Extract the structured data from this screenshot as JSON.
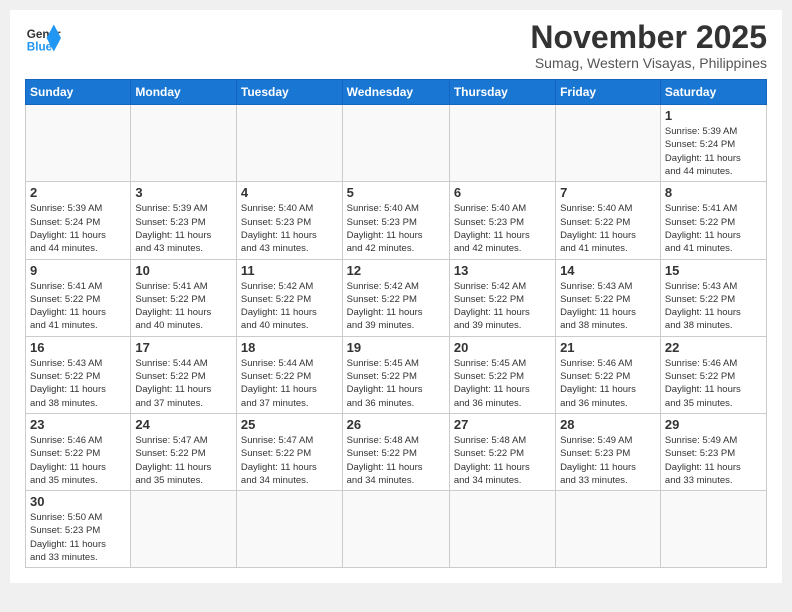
{
  "header": {
    "logo_general": "General",
    "logo_blue": "Blue",
    "month_title": "November 2025",
    "subtitle": "Sumag, Western Visayas, Philippines"
  },
  "days_of_week": [
    "Sunday",
    "Monday",
    "Tuesday",
    "Wednesday",
    "Thursday",
    "Friday",
    "Saturday"
  ],
  "weeks": [
    [
      {
        "day": "",
        "info": ""
      },
      {
        "day": "",
        "info": ""
      },
      {
        "day": "",
        "info": ""
      },
      {
        "day": "",
        "info": ""
      },
      {
        "day": "",
        "info": ""
      },
      {
        "day": "",
        "info": ""
      },
      {
        "day": "1",
        "info": "Sunrise: 5:39 AM\nSunset: 5:24 PM\nDaylight: 11 hours\nand 44 minutes."
      }
    ],
    [
      {
        "day": "2",
        "info": "Sunrise: 5:39 AM\nSunset: 5:24 PM\nDaylight: 11 hours\nand 44 minutes."
      },
      {
        "day": "3",
        "info": "Sunrise: 5:39 AM\nSunset: 5:23 PM\nDaylight: 11 hours\nand 43 minutes."
      },
      {
        "day": "4",
        "info": "Sunrise: 5:40 AM\nSunset: 5:23 PM\nDaylight: 11 hours\nand 43 minutes."
      },
      {
        "day": "5",
        "info": "Sunrise: 5:40 AM\nSunset: 5:23 PM\nDaylight: 11 hours\nand 42 minutes."
      },
      {
        "day": "6",
        "info": "Sunrise: 5:40 AM\nSunset: 5:23 PM\nDaylight: 11 hours\nand 42 minutes."
      },
      {
        "day": "7",
        "info": "Sunrise: 5:40 AM\nSunset: 5:22 PM\nDaylight: 11 hours\nand 41 minutes."
      },
      {
        "day": "8",
        "info": "Sunrise: 5:41 AM\nSunset: 5:22 PM\nDaylight: 11 hours\nand 41 minutes."
      }
    ],
    [
      {
        "day": "9",
        "info": "Sunrise: 5:41 AM\nSunset: 5:22 PM\nDaylight: 11 hours\nand 41 minutes."
      },
      {
        "day": "10",
        "info": "Sunrise: 5:41 AM\nSunset: 5:22 PM\nDaylight: 11 hours\nand 40 minutes."
      },
      {
        "day": "11",
        "info": "Sunrise: 5:42 AM\nSunset: 5:22 PM\nDaylight: 11 hours\nand 40 minutes."
      },
      {
        "day": "12",
        "info": "Sunrise: 5:42 AM\nSunset: 5:22 PM\nDaylight: 11 hours\nand 39 minutes."
      },
      {
        "day": "13",
        "info": "Sunrise: 5:42 AM\nSunset: 5:22 PM\nDaylight: 11 hours\nand 39 minutes."
      },
      {
        "day": "14",
        "info": "Sunrise: 5:43 AM\nSunset: 5:22 PM\nDaylight: 11 hours\nand 38 minutes."
      },
      {
        "day": "15",
        "info": "Sunrise: 5:43 AM\nSunset: 5:22 PM\nDaylight: 11 hours\nand 38 minutes."
      }
    ],
    [
      {
        "day": "16",
        "info": "Sunrise: 5:43 AM\nSunset: 5:22 PM\nDaylight: 11 hours\nand 38 minutes."
      },
      {
        "day": "17",
        "info": "Sunrise: 5:44 AM\nSunset: 5:22 PM\nDaylight: 11 hours\nand 37 minutes."
      },
      {
        "day": "18",
        "info": "Sunrise: 5:44 AM\nSunset: 5:22 PM\nDaylight: 11 hours\nand 37 minutes."
      },
      {
        "day": "19",
        "info": "Sunrise: 5:45 AM\nSunset: 5:22 PM\nDaylight: 11 hours\nand 36 minutes."
      },
      {
        "day": "20",
        "info": "Sunrise: 5:45 AM\nSunset: 5:22 PM\nDaylight: 11 hours\nand 36 minutes."
      },
      {
        "day": "21",
        "info": "Sunrise: 5:46 AM\nSunset: 5:22 PM\nDaylight: 11 hours\nand 36 minutes."
      },
      {
        "day": "22",
        "info": "Sunrise: 5:46 AM\nSunset: 5:22 PM\nDaylight: 11 hours\nand 35 minutes."
      }
    ],
    [
      {
        "day": "23",
        "info": "Sunrise: 5:46 AM\nSunset: 5:22 PM\nDaylight: 11 hours\nand 35 minutes."
      },
      {
        "day": "24",
        "info": "Sunrise: 5:47 AM\nSunset: 5:22 PM\nDaylight: 11 hours\nand 35 minutes."
      },
      {
        "day": "25",
        "info": "Sunrise: 5:47 AM\nSunset: 5:22 PM\nDaylight: 11 hours\nand 34 minutes."
      },
      {
        "day": "26",
        "info": "Sunrise: 5:48 AM\nSunset: 5:22 PM\nDaylight: 11 hours\nand 34 minutes."
      },
      {
        "day": "27",
        "info": "Sunrise: 5:48 AM\nSunset: 5:22 PM\nDaylight: 11 hours\nand 34 minutes."
      },
      {
        "day": "28",
        "info": "Sunrise: 5:49 AM\nSunset: 5:23 PM\nDaylight: 11 hours\nand 33 minutes."
      },
      {
        "day": "29",
        "info": "Sunrise: 5:49 AM\nSunset: 5:23 PM\nDaylight: 11 hours\nand 33 minutes."
      }
    ],
    [
      {
        "day": "30",
        "info": "Sunrise: 5:50 AM\nSunset: 5:23 PM\nDaylight: 11 hours\nand 33 minutes."
      },
      {
        "day": "",
        "info": ""
      },
      {
        "day": "",
        "info": ""
      },
      {
        "day": "",
        "info": ""
      },
      {
        "day": "",
        "info": ""
      },
      {
        "day": "",
        "info": ""
      },
      {
        "day": "",
        "info": ""
      }
    ]
  ]
}
